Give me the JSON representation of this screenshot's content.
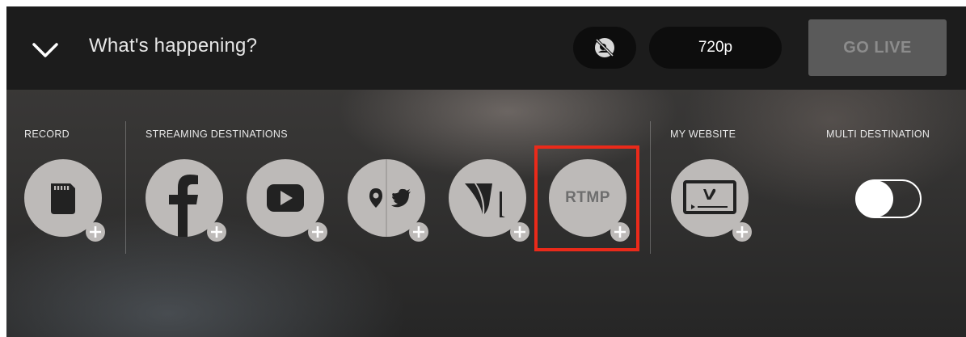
{
  "topbar": {
    "collapse_icon": "chevron-down-icon",
    "status_text": "What's happening?",
    "camera_toggle_icon": "camera-off-icon",
    "resolution": "720p",
    "go_live_label": "GO LIVE"
  },
  "sections": {
    "record": "RECORD",
    "streaming": "STREAMING DESTINATIONS",
    "website": "MY WEBSITE",
    "multi": "MULTI DESTINATION"
  },
  "destinations": [
    {
      "id": "record-sd-card",
      "icon": "sd-card-icon"
    },
    {
      "id": "facebook",
      "icon": "facebook-icon"
    },
    {
      "id": "youtube",
      "icon": "youtube-icon"
    },
    {
      "id": "periscope-twitter",
      "icon": "periscope-twitter-icon"
    },
    {
      "id": "vimeo-livestream",
      "icon": "livestream-icon"
    },
    {
      "id": "rtmp",
      "icon": "rtmp-icon",
      "label": "RTMP",
      "highlighted": true
    },
    {
      "id": "my-website",
      "icon": "vimeo-player-icon"
    }
  ],
  "multi_destination": {
    "enabled": false
  },
  "colors": {
    "highlight": "#ea2a1a",
    "circle": "#bdbab8",
    "topbar": "#1c1c1c",
    "go_live_bg": "#5a5a5a"
  }
}
